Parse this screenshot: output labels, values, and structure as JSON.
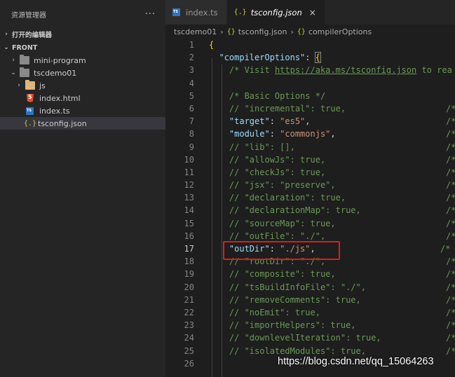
{
  "sidebar": {
    "title": "资源管理器",
    "more": "···",
    "open_editors": "打开的编辑器",
    "workspace": "FRONT",
    "tree": [
      {
        "label": "mini-program",
        "kind": "folder",
        "expanded": false,
        "depth": 1
      },
      {
        "label": "tscdemo01",
        "kind": "folder",
        "expanded": true,
        "depth": 1
      },
      {
        "label": "js",
        "kind": "folder-js",
        "expanded": false,
        "depth": 2
      },
      {
        "label": "index.html",
        "kind": "html",
        "depth": 2
      },
      {
        "label": "index.ts",
        "kind": "ts",
        "depth": 2
      },
      {
        "label": "tsconfig.json",
        "kind": "json",
        "depth": 2,
        "selected": true
      }
    ]
  },
  "tabs": [
    {
      "label": "index.ts",
      "icon": "ts-icon",
      "active": false
    },
    {
      "label": "tsconfig.json",
      "icon": "json-icon",
      "active": true,
      "close": "×"
    }
  ],
  "breadcrumbs": [
    "tscdemo01",
    "tsconfig.json",
    "compilerOptions"
  ],
  "breadcrumb_sep": "›",
  "json_glyph": "{.}",
  "json_glyph_crumb": "{}",
  "line_numbers": [
    "1",
    "2",
    "3",
    "4",
    "5",
    "6",
    "7",
    "8",
    "9",
    "10",
    "11",
    "12",
    "13",
    "14",
    "15",
    "16",
    "17",
    "18",
    "19",
    "20",
    "21",
    "22",
    "23",
    "24",
    "25",
    "26"
  ],
  "code": {
    "l1": "{",
    "l2_key": "\"compilerOptions\"",
    "l2_colon": ": ",
    "l2_brace": "{",
    "l3_pre": "/* Visit ",
    "l3_link": "https://aka.ms/tsconfig.json",
    "l3_post": " to rea",
    "l5": "/* Basic Options */",
    "l6": "// \"incremental\": true,",
    "l7_key": "\"target\"",
    "l7_val": "\"es5\"",
    "l8_key": "\"module\"",
    "l8_val": "\"commonjs\"",
    "l9": "// \"lib\": [],",
    "l10": "// \"allowJs\": true,",
    "l11": "// \"checkJs\": true,",
    "l12": "// \"jsx\": \"preserve\",",
    "l13": "// \"declaration\": true,",
    "l14": "// \"declarationMap\": true,",
    "l15": "// \"sourceMap\": true,",
    "l16": "// \"outFile\": \"./\",",
    "l17_key": "\"outDir\"",
    "l17_val": "\"./js\"",
    "l18": "// \"rootDir\": \"./\",",
    "l19": "// \"composite\": true,",
    "l20": "// \"tsBuildInfoFile\": \"./\",",
    "l21": "// \"removeComments\": true,",
    "l22": "// \"noEmit\": true,",
    "l23": "// \"importHelpers\": true,",
    "l24": "// \"downlevelIteration\": true,",
    "l25": "// \"isolatedModules\": true,",
    "tail": "/*"
  },
  "watermark": "https://blog.csdn.net/qq_15064263",
  "colors": {
    "highlight_box": "#e0191d",
    "accent_tab": "#1e1e1e"
  }
}
